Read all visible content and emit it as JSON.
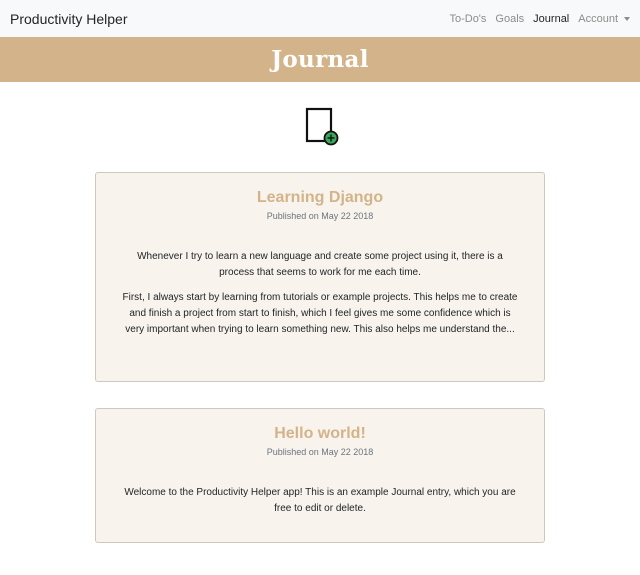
{
  "navbar": {
    "brand": "Productivity Helper",
    "links": [
      {
        "label": "To-Do's"
      },
      {
        "label": "Goals"
      },
      {
        "label": "Journal"
      }
    ],
    "account_label": "Account"
  },
  "banner": {
    "title": "Journal"
  },
  "new_entry": {
    "icon": "new-document-icon"
  },
  "entries": [
    {
      "title": "Learning Django",
      "published": "Published on May 22 2018",
      "paragraphs": [
        "Whenever I try to learn a new language and create some project using it, there is a process that seems to work for me each time.",
        "First, I always start by learning from tutorials or example projects. This helps me to create and finish a project from start to finish, which I feel gives me some confidence which is very important when trying to learn something new. This also helps me understand the..."
      ]
    },
    {
      "title": "Hello world!",
      "published": "Published on May 22 2018",
      "paragraphs": [
        "Welcome to the Productivity Helper app! This is an example Journal entry, which you are free to edit or delete."
      ]
    }
  ],
  "colors": {
    "accent": "#d3b48a",
    "card_bg": "#f8f3ed",
    "plus_green": "#3aa65a"
  }
}
